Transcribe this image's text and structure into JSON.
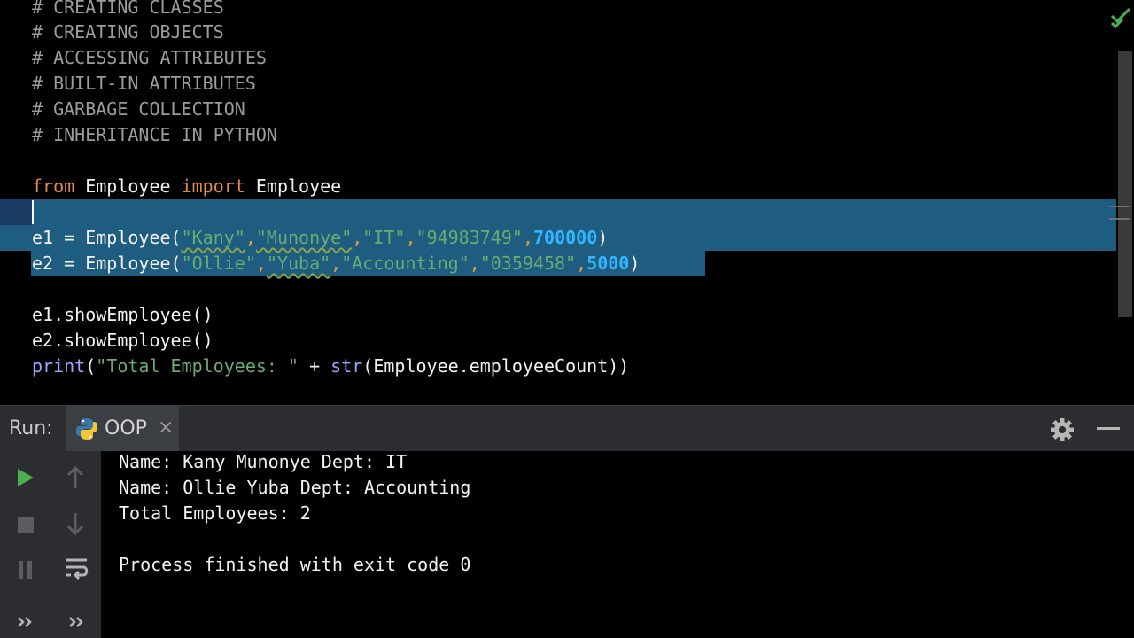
{
  "editor": {
    "comments": [
      "# CREATING CLASSES",
      "# CREATING OBJECTS",
      "# ACCESSING ATTRIBUTES",
      "# BUILT-IN ATTRIBUTES",
      "# GARBAGE COLLECTION",
      "# INHERITANCE IN PYTHON"
    ],
    "import_line": {
      "kw_from": "from",
      "module": " Employee ",
      "kw_import": "import",
      "name": " Employee"
    },
    "e1": {
      "prefix": "e1 = Employee(",
      "args": [
        "\"Kany\"",
        "\"Munonye\"",
        "\"IT\"",
        "\"94983749\""
      ],
      "num": "700000",
      "suffix": ")"
    },
    "e2": {
      "prefix": "e2 = Employee(",
      "args": [
        "\"Ollie\"",
        "\"Yuba\"",
        "\"Accounting\"",
        "\"0359458\""
      ],
      "num": "5000",
      "suffix": ")"
    },
    "show1": "e1.showEmployee()",
    "show2": "e2.showEmployee()",
    "print_line": {
      "fn": "print",
      "open": "(",
      "str": "\"Total Employees: \"",
      "mid": " + ",
      "fn2": "str",
      "rest": "(Employee.employeeCount))"
    },
    "separator": ",",
    "status_icon": "check-icon"
  },
  "run_panel": {
    "label": "Run:",
    "tab_label": "OOP",
    "tab_close": "×",
    "output": [
      "Name: Kany Munonye Dept: IT",
      "Name: Ollie Yuba Dept: Accounting",
      "Total Employees: 2",
      "",
      "Process finished with exit code 0"
    ]
  },
  "colors": {
    "selection": "#1e5c80",
    "run_green": "#4caf50",
    "panel_bg": "#2b2d30"
  }
}
